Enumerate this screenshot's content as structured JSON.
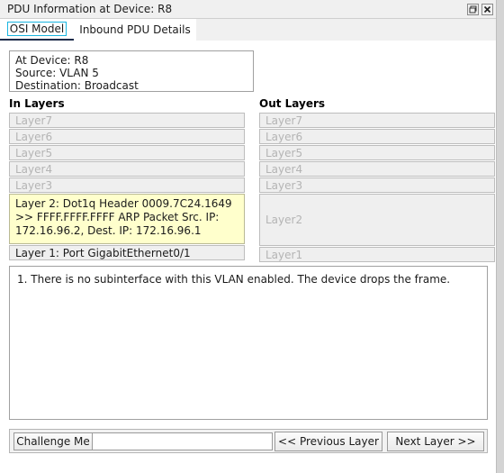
{
  "window": {
    "title": "PDU Information at Device: R8",
    "buttons": [
      {
        "name": "restore-button",
        "glyph": "restore"
      },
      {
        "name": "close-button",
        "glyph": "close"
      }
    ]
  },
  "tabs": [
    {
      "label": "OSI Model",
      "active": true
    },
    {
      "label": "Inbound PDU Details",
      "active": false
    }
  ],
  "info": {
    "at_device": "At Device: R8",
    "source": "Source: VLAN 5",
    "destination": "Destination: Broadcast"
  },
  "headings": {
    "in": "In Layers",
    "out": "Out Layers"
  },
  "in_layers": [
    {
      "label": "Layer7",
      "state": "empty"
    },
    {
      "label": "Layer6",
      "state": "empty"
    },
    {
      "label": "Layer5",
      "state": "empty"
    },
    {
      "label": "Layer4",
      "state": "empty"
    },
    {
      "label": "Layer3",
      "state": "empty"
    },
    {
      "label": "Layer 2: Dot1q Header 0009.7C24.1649 >> FFFF.FFFF.FFFF ARP Packet Src. IP: 172.16.96.2, Dest. IP: 172.16.96.1",
      "state": "active"
    },
    {
      "label": "Layer 1: Port GigabitEthernet0/1",
      "state": "filled"
    }
  ],
  "out_layers": [
    {
      "label": "Layer7",
      "state": "empty"
    },
    {
      "label": "Layer6",
      "state": "empty"
    },
    {
      "label": "Layer5",
      "state": "empty"
    },
    {
      "label": "Layer4",
      "state": "empty"
    },
    {
      "label": "Layer3",
      "state": "empty"
    },
    {
      "label": "Layer2",
      "state": "tall"
    },
    {
      "label": "Layer1",
      "state": "empty"
    }
  ],
  "description": {
    "lines": [
      "1. There is no subinterface with this VLAN enabled. The device drops the frame."
    ]
  },
  "bottom": {
    "challenge_label": "Challenge Me",
    "input_value": "",
    "input_placeholder": "",
    "prev_label": "<< Previous Layer",
    "next_label": "Next Layer >>"
  },
  "colors": {
    "accent_focus": "#19b5e0",
    "tab_underline": "#1c2b4a",
    "active_layer_bg": "#ffffcc",
    "panel_bg": "#efefef",
    "frame": "#d4d4d4"
  }
}
